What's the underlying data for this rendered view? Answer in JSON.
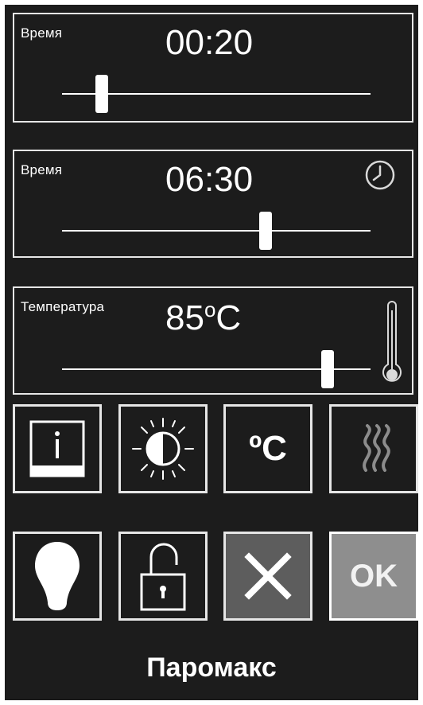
{
  "panels": {
    "time1": {
      "label": "Время",
      "value": "00:20",
      "slider_fraction": 0.13
    },
    "time2": {
      "label": "Время",
      "value": "06:30",
      "slider_fraction": 0.66,
      "icon": "clock-icon"
    },
    "temperature": {
      "label": "Температура",
      "value": "85",
      "unit_degree": "o",
      "unit_scale": "C",
      "slider_fraction": 0.86,
      "icon": "thermometer-icon"
    }
  },
  "buttons_row1": {
    "info": {
      "icon": "info-icon"
    },
    "brightness": {
      "icon": "brightness-contrast-icon"
    },
    "celsius": {
      "label": "ºC"
    },
    "steam": {
      "icon": "steam-icon"
    }
  },
  "buttons_row2": {
    "light": {
      "icon": "light-bulb-icon"
    },
    "lock": {
      "icon": "unlocked-padlock-icon"
    },
    "cancel": {
      "icon": "close-icon"
    },
    "ok": {
      "label": "OK"
    }
  },
  "brand": "Паромакс",
  "colors": {
    "background": "#1c1c1c",
    "border": "#e6e6e6",
    "cancel_bg": "#5d5d5d",
    "ok_bg": "#8e8e8e",
    "steam_icon": "#8c8c8c"
  }
}
